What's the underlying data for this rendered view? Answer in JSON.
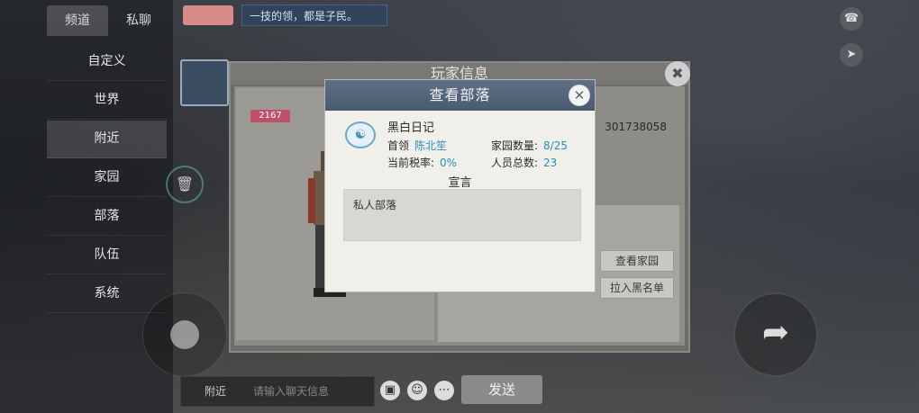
{
  "chat": {
    "tabs": [
      {
        "label": "频道"
      },
      {
        "label": "私聊"
      }
    ],
    "channels": [
      {
        "label": "自定义"
      },
      {
        "label": "世界"
      },
      {
        "label": "附近"
      },
      {
        "label": "家园"
      },
      {
        "label": "部落"
      },
      {
        "label": "队伍"
      },
      {
        "label": "系统"
      }
    ],
    "input_channel": "附近",
    "input_placeholder": "请输入聊天信息",
    "send_label": "发送",
    "top_message": "一技的领，都是子民。"
  },
  "player_panel": {
    "title": "玩家信息",
    "score": "2167",
    "player_id": "301738058",
    "view_home_label": "查看家园",
    "blacklist_label": "拉入黑名单"
  },
  "tribe_dialog": {
    "title": "查看部落",
    "name": "黑白日记",
    "leader_label": "首领",
    "leader_value": "陈北笙",
    "tax_label": "当前税率:",
    "tax_value": "0%",
    "home_count_label": "家园数量:",
    "home_count_value": "8/25",
    "member_label": "人员总数:",
    "member_value": "23",
    "proclamation_label": "宣言",
    "proclamation_text": "私人部落"
  },
  "colors": {
    "header_bg": "#55657a",
    "value_blue": "#2a8fb8",
    "dialog_bg": "#f0efea"
  }
}
